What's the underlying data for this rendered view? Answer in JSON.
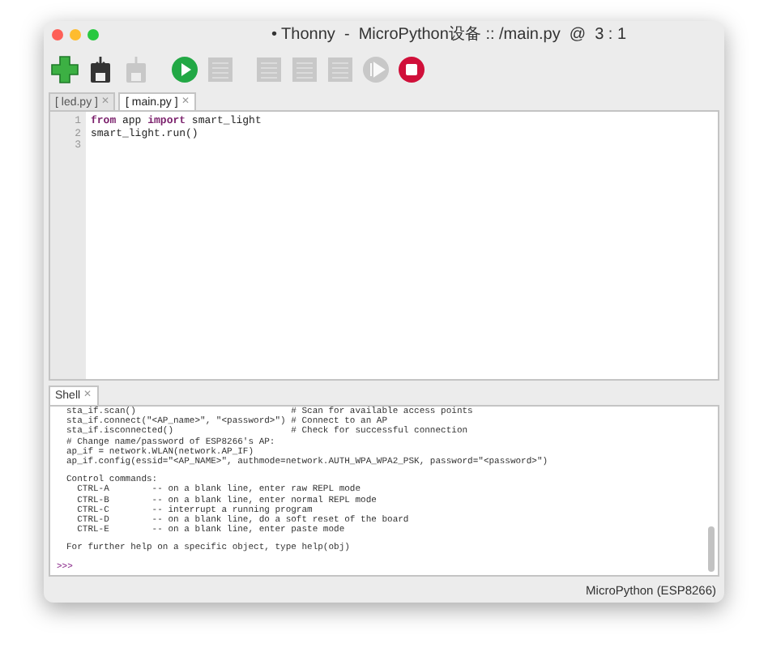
{
  "window": {
    "title": "• Thonny  -  MicroPython设备 :: /main.py  @  3 : 1"
  },
  "toolbar": [
    {
      "kind": "new",
      "disabled": false
    },
    {
      "kind": "load",
      "disabled": false
    },
    {
      "kind": "save",
      "disabled": true
    },
    {
      "kind": "run",
      "disabled": false
    },
    {
      "kind": "debug",
      "disabled": true
    },
    {
      "kind": "step",
      "disabled": true
    },
    {
      "kind": "step",
      "disabled": true
    },
    {
      "kind": "step",
      "disabled": true
    },
    {
      "kind": "resume",
      "disabled": true
    },
    {
      "kind": "stop",
      "disabled": false
    }
  ],
  "editor_tabs": [
    {
      "label": "[ led.py ]",
      "close": "✕",
      "selected": false
    },
    {
      "label": "[ main.py ]",
      "close": "✕",
      "selected": true
    }
  ],
  "editor": {
    "lines": [
      {
        "number": "1",
        "code": "**from** app **import** smart_light"
      },
      {
        "number": "2",
        "code": "smart_light.run()"
      },
      {
        "number": "3"
      }
    ]
  },
  "shell_tab": {
    "label": "Shell",
    "close": "✕"
  },
  "shell": {
    "blocks": [
      [
        "sta_if.scan()                             # Scan for available access points",
        "sta_if.connect(\"<AP_name>\", \"<password>\") # Connect to an AP",
        "sta_if.isconnected()                      # Check for successful connection",
        "# Change name/password of ESP8266's AP:",
        "ap_if = network.WLAN(network.AP_IF)",
        "ap_if.config(essid=\"<AP_NAME>\", authmode=network.AUTH_WPA_WPA2_PSK, password=\"<password>\")"
      ],
      [
        "Control commands:",
        "  CTRL-A        -- on a blank line, enter raw REPL mode",
        "  CTRL-B        -- on a blank line, enter normal REPL mode",
        "  CTRL-C        -- interrupt a running program",
        "  CTRL-D        -- on a blank line, do a soft reset of the board",
        "  CTRL-E        -- on a blank line, enter paste mode"
      ],
      [
        "For further help on a specific object, type help(obj)"
      ]
    ],
    "prompt": ">>>"
  },
  "status_bar": {
    "interpreter": "MicroPython (ESP8266)"
  }
}
